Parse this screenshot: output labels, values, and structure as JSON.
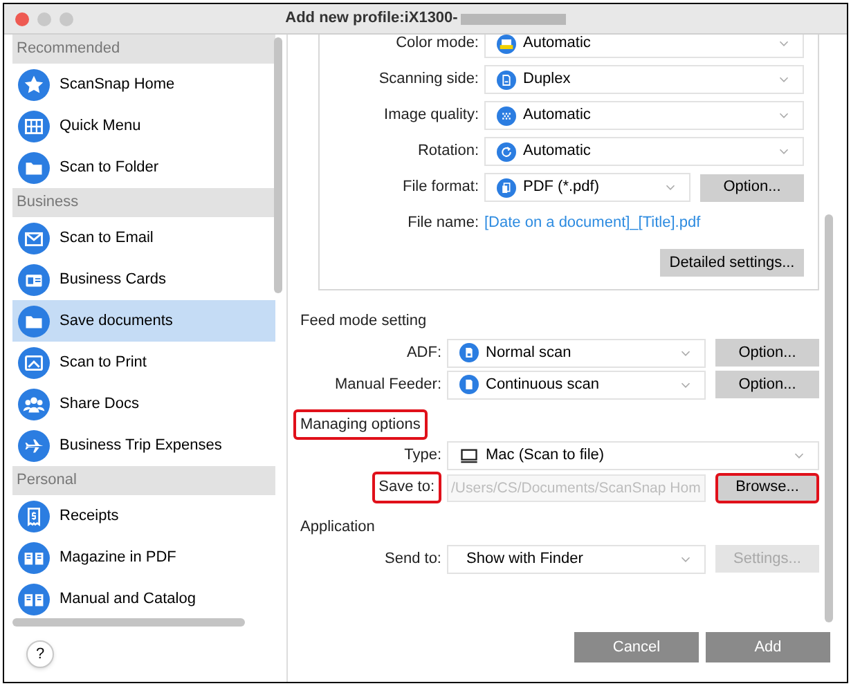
{
  "window": {
    "title": "Add new profile:iX1300-"
  },
  "sidebar": {
    "sections": [
      {
        "label": "Recommended",
        "items": [
          {
            "label": "ScanSnap Home",
            "selected": false
          },
          {
            "label": "Quick Menu",
            "selected": false
          },
          {
            "label": "Scan to Folder",
            "selected": false
          }
        ]
      },
      {
        "label": "Business",
        "items": [
          {
            "label": "Scan to Email",
            "selected": false
          },
          {
            "label": "Business Cards",
            "selected": false
          },
          {
            "label": "Save documents",
            "selected": true
          },
          {
            "label": "Scan to Print",
            "selected": false
          },
          {
            "label": "Share Docs",
            "selected": false
          },
          {
            "label": "Business Trip Expenses",
            "selected": false
          }
        ]
      },
      {
        "label": "Personal",
        "items": [
          {
            "label": "Receipts",
            "selected": false
          },
          {
            "label": "Magazine in PDF",
            "selected": false
          },
          {
            "label": "Manual and Catalog",
            "selected": false
          }
        ]
      }
    ]
  },
  "scan_settings": {
    "rows": [
      {
        "kind": "select",
        "label": "Color mode:",
        "value": "Automatic",
        "label_highlighted": false
      },
      {
        "kind": "select",
        "label": "Scanning side:",
        "value": "Duplex",
        "label_highlighted": false
      },
      {
        "kind": "select",
        "label": "Image quality:",
        "value": "Automatic",
        "label_highlighted": false
      },
      {
        "kind": "select",
        "label": "Rotation:",
        "value": "Automatic",
        "label_highlighted": false
      },
      {
        "kind": "select",
        "label": "File format:",
        "value": "PDF (*.pdf)",
        "label_highlighted": false,
        "button": {
          "label": "Option...",
          "disabled": false,
          "highlighted": false
        }
      },
      {
        "kind": "link",
        "label": "File name:",
        "value": "[Date on a document]_[Title].pdf",
        "label_highlighted": false
      }
    ],
    "detail_button": {
      "label": "Detailed settings...",
      "disabled": false,
      "highlighted": false
    }
  },
  "sections": [
    {
      "heading": "Feed mode setting",
      "highlighted": false,
      "rows": [
        {
          "kind": "select",
          "label": "ADF:",
          "value": "Normal scan",
          "label_highlighted": false,
          "button": {
            "label": "Option...",
            "disabled": false,
            "highlighted": false
          }
        },
        {
          "kind": "select",
          "label": "Manual Feeder:",
          "value": "Continuous scan",
          "label_highlighted": false,
          "button": {
            "label": "Option...",
            "disabled": false,
            "highlighted": false
          }
        }
      ]
    },
    {
      "heading": "Managing options",
      "highlighted": true,
      "rows": [
        {
          "kind": "select",
          "label": "Type:",
          "value": "Mac (Scan to file)",
          "label_highlighted": false
        },
        {
          "kind": "path",
          "label": "Save to:",
          "placeholder": "/Users/CS/Documents/ScanSnap Hom",
          "label_highlighted": true,
          "button": {
            "label": "Browse...",
            "disabled": false,
            "highlighted": true
          }
        }
      ]
    },
    {
      "heading": "Application",
      "highlighted": false,
      "rows": [
        {
          "kind": "select",
          "label": "Send to:",
          "value": "Show with Finder",
          "label_highlighted": false,
          "button": {
            "label": "Settings...",
            "disabled": true,
            "highlighted": false
          }
        }
      ]
    }
  ],
  "footer": {
    "help": "?",
    "buttons": [
      "Cancel",
      "Add"
    ]
  }
}
